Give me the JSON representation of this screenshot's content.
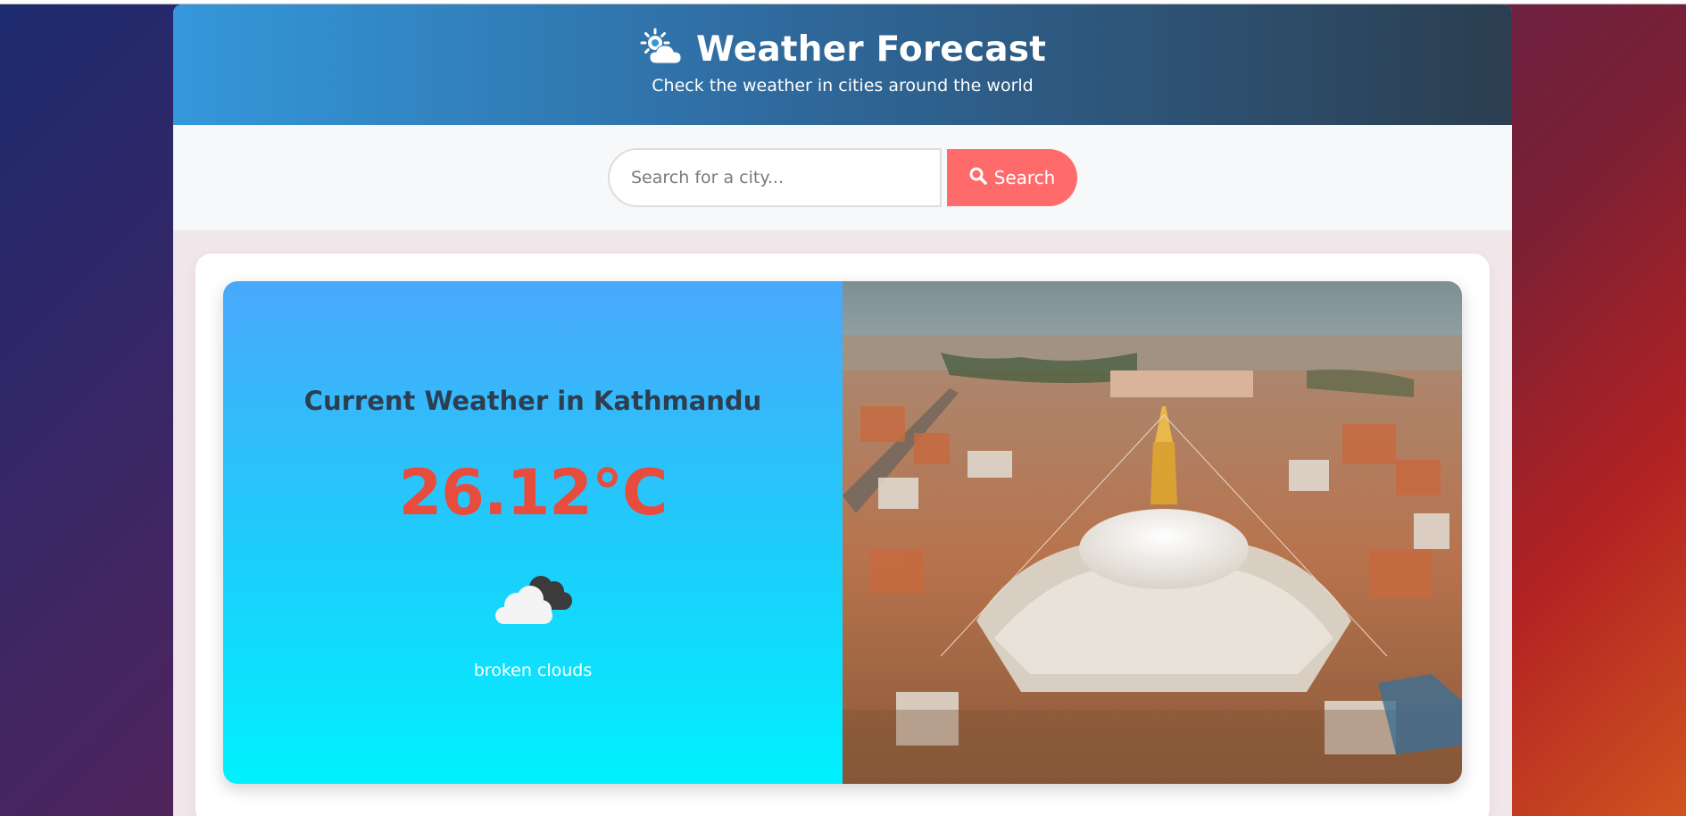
{
  "header": {
    "icon": "sun-behind-cloud-icon",
    "title": "Weather Forecast",
    "subtitle": "Check the weather in cities around the world"
  },
  "search": {
    "placeholder": "Search for a city...",
    "value": "",
    "button_label": "Search",
    "button_icon": "magnifier-icon"
  },
  "current": {
    "heading": "Current Weather in Kathmandu",
    "temperature": "26.12°C",
    "condition_icon": "broken-clouds-icon",
    "description": "broken clouds",
    "photo": "kathmandu-boudhanath-stupa-aerial-photo"
  },
  "colors": {
    "header_start": "#3498db",
    "header_end": "#2c3e50",
    "search_button": "#ff6b6b",
    "temperature": "#e74c3c",
    "heading": "#2c3e50",
    "panel_top": "#4aa8fb",
    "panel_bottom": "#00f1fe"
  }
}
